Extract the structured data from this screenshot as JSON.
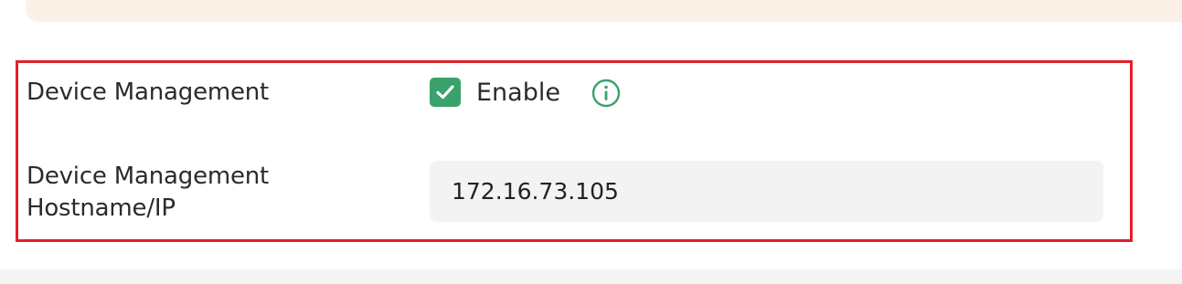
{
  "device_management": {
    "label": "Device Management",
    "checkbox_checked": true,
    "enable_label": "Enable",
    "info_icon": "info-circle-icon"
  },
  "hostname": {
    "label": "Device Management Hostname/IP",
    "value": "172.16.73.105"
  },
  "colors": {
    "accent_green": "#3aa26b",
    "highlight_red": "#e0202b",
    "banner_bg": "#fcf1e6",
    "input_bg": "#f3f3f3"
  }
}
